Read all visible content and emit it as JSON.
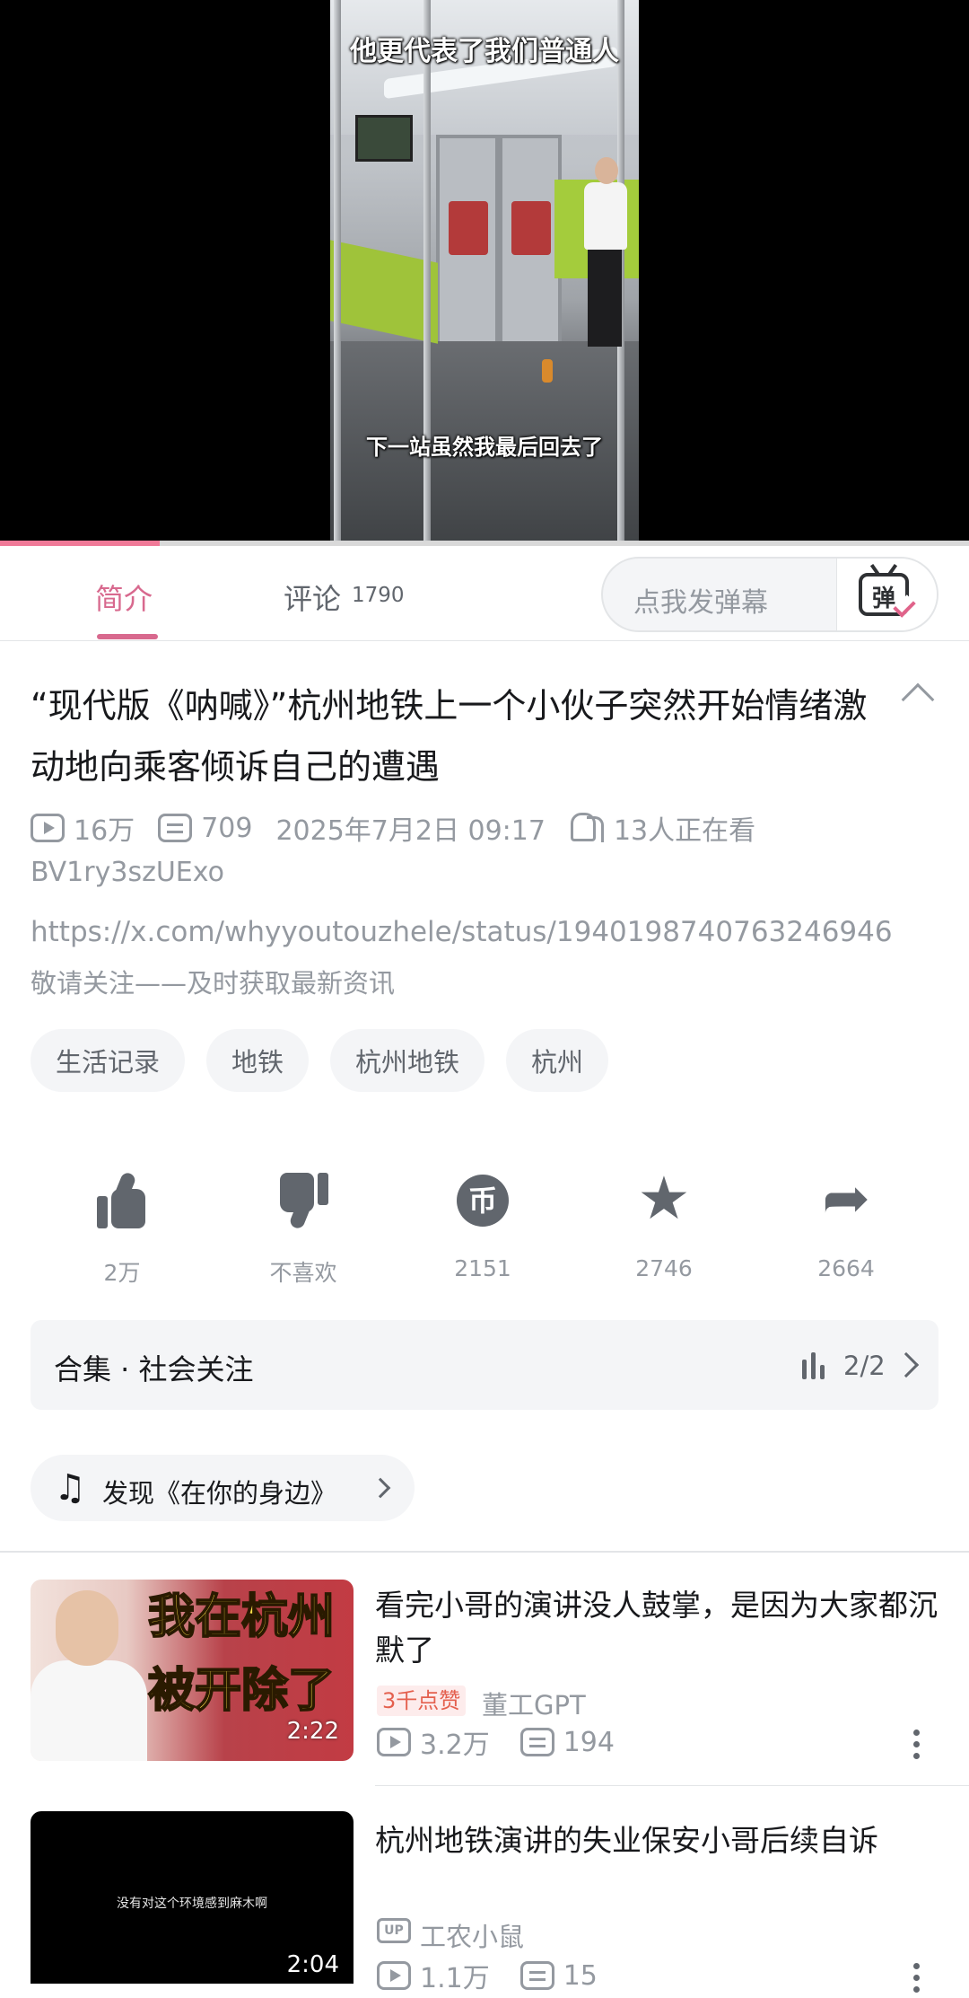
{
  "player": {
    "subtitle_top": "他更代表了我们普通人",
    "subtitle_bottom": "下一站虽然我最后回去了",
    "progress": 0.165
  },
  "tabs": {
    "intro": "简介",
    "comments": "评论",
    "comments_count": "1790",
    "danmaku_placeholder": "点我发弹幕",
    "danmaku_button": "弹"
  },
  "video": {
    "title": "“现代版《呐喊》”杭州地铁上一个小伙子突然开始情绪激动地向乘客倾诉自己的遭遇",
    "views": "16万",
    "danmaku": "709",
    "date": "2025年7月2日 09:17",
    "watching": "13人正在看",
    "bvid": "BV1ry3szUExo",
    "desc_url": "https://x.com/whyyoutouzhele/status/1940198740763246946",
    "desc_text": "敬请关注——及时获取最新资讯",
    "tags": [
      "生活记录",
      "地铁",
      "杭州地铁",
      "杭州"
    ]
  },
  "actions": {
    "like": "2万",
    "dislike": "不喜欢",
    "coin": "2151",
    "coin_glyph": "币",
    "favorite": "2746",
    "share": "2664"
  },
  "collection": {
    "label": "合集 · 社会关注",
    "progress": "2/2"
  },
  "music": {
    "label": "发现《在你的身边》"
  },
  "related": [
    {
      "thumb_text_1": "我在杭州",
      "thumb_text_2": "被开除了",
      "duration": "2:22",
      "title": "看完小哥的演讲没人鼓掌，是因为大家都沉默了",
      "badge": "3千点赞",
      "uploader": "董工GPT",
      "views": "3.2万",
      "danmaku": "194"
    },
    {
      "thumb_caption": "没有对这个环境感到麻木啊",
      "duration": "2:04",
      "title": "杭州地铁演讲的失业保安小哥后续自诉",
      "up_label": "UP",
      "uploader": "工农小鼠",
      "views": "1.1万",
      "danmaku": "15"
    }
  ],
  "colors": {
    "accent": "#d8698e",
    "text_secondary": "#9499a0",
    "badge_text": "#e4604e"
  }
}
